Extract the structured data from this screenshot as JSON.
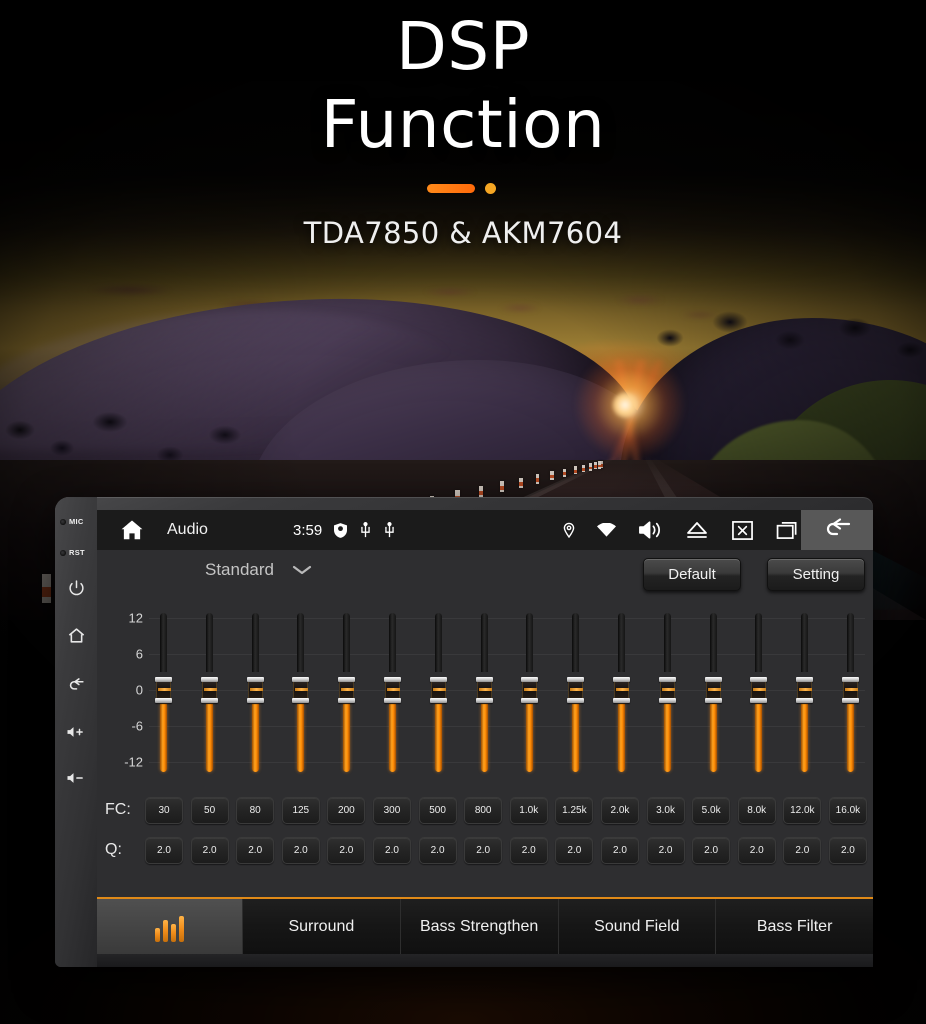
{
  "hero": {
    "title_line1": "DSP",
    "title_line2": "Function",
    "subtitle": "TDA7850 & AKM7604",
    "accent_color": "#ff8a1a",
    "dot_color": "#f5a623"
  },
  "device": {
    "bezel": {
      "items": [
        {
          "name": "mic-indicator",
          "label": "MIC"
        },
        {
          "name": "reset-indicator",
          "label": "RST"
        },
        {
          "name": "power-button",
          "icon": "power-icon"
        },
        {
          "name": "home-button",
          "icon": "home-icon"
        },
        {
          "name": "back-button",
          "icon": "back-arrow-icon"
        },
        {
          "name": "volume-up-button",
          "icon": "volume-up-icon"
        },
        {
          "name": "volume-down-button",
          "icon": "volume-down-icon"
        }
      ]
    },
    "statusbar": {
      "home_icon": "home-icon",
      "title": "Audio",
      "time": "3:59",
      "left_icons": [
        "shield-icon",
        "usb-icon",
        "usb-icon"
      ],
      "right_icons": [
        "location-pin-icon",
        "wifi-icon",
        "volume-icon",
        "eject-icon",
        "close-box-icon",
        "recent-apps-icon"
      ],
      "back_icon": "back-arrow-icon"
    },
    "toolbar": {
      "preset": "Standard",
      "preset_chevron": "chevron-down-icon",
      "default_label": "Default",
      "setting_label": "Setting"
    },
    "equalizer": {
      "axis_labels": [
        "12",
        "6",
        "0",
        "-6",
        "-12"
      ],
      "axis_unit_range": [
        -12,
        12
      ],
      "fc_label": "FC:",
      "q_label": "Q:",
      "bands": [
        {
          "fc": "30",
          "q": "2.0",
          "gain": 0
        },
        {
          "fc": "50",
          "q": "2.0",
          "gain": 0
        },
        {
          "fc": "80",
          "q": "2.0",
          "gain": 0
        },
        {
          "fc": "125",
          "q": "2.0",
          "gain": 0
        },
        {
          "fc": "200",
          "q": "2.0",
          "gain": 0
        },
        {
          "fc": "300",
          "q": "2.0",
          "gain": 0
        },
        {
          "fc": "500",
          "q": "2.0",
          "gain": 0
        },
        {
          "fc": "800",
          "q": "2.0",
          "gain": 0
        },
        {
          "fc": "1.0k",
          "q": "2.0",
          "gain": 0
        },
        {
          "fc": "1.25k",
          "q": "2.0",
          "gain": 0
        },
        {
          "fc": "2.0k",
          "q": "2.0",
          "gain": 0
        },
        {
          "fc": "3.0k",
          "q": "2.0",
          "gain": 0
        },
        {
          "fc": "5.0k",
          "q": "2.0",
          "gain": 0
        },
        {
          "fc": "8.0k",
          "q": "2.0",
          "gain": 0
        },
        {
          "fc": "12.0k",
          "q": "2.0",
          "gain": 0
        },
        {
          "fc": "16.0k",
          "q": "2.0",
          "gain": 0
        }
      ]
    },
    "tabs": [
      {
        "name": "tab-equalizer",
        "label": "",
        "icon": "equalizer-icon",
        "active": true
      },
      {
        "name": "tab-surround",
        "label": "Surround",
        "active": false
      },
      {
        "name": "tab-bass-strengthen",
        "label": "Bass Strengthen",
        "active": false
      },
      {
        "name": "tab-sound-field",
        "label": "Sound Field",
        "active": false
      },
      {
        "name": "tab-bass-filter",
        "label": "Bass Filter",
        "active": false
      }
    ]
  }
}
